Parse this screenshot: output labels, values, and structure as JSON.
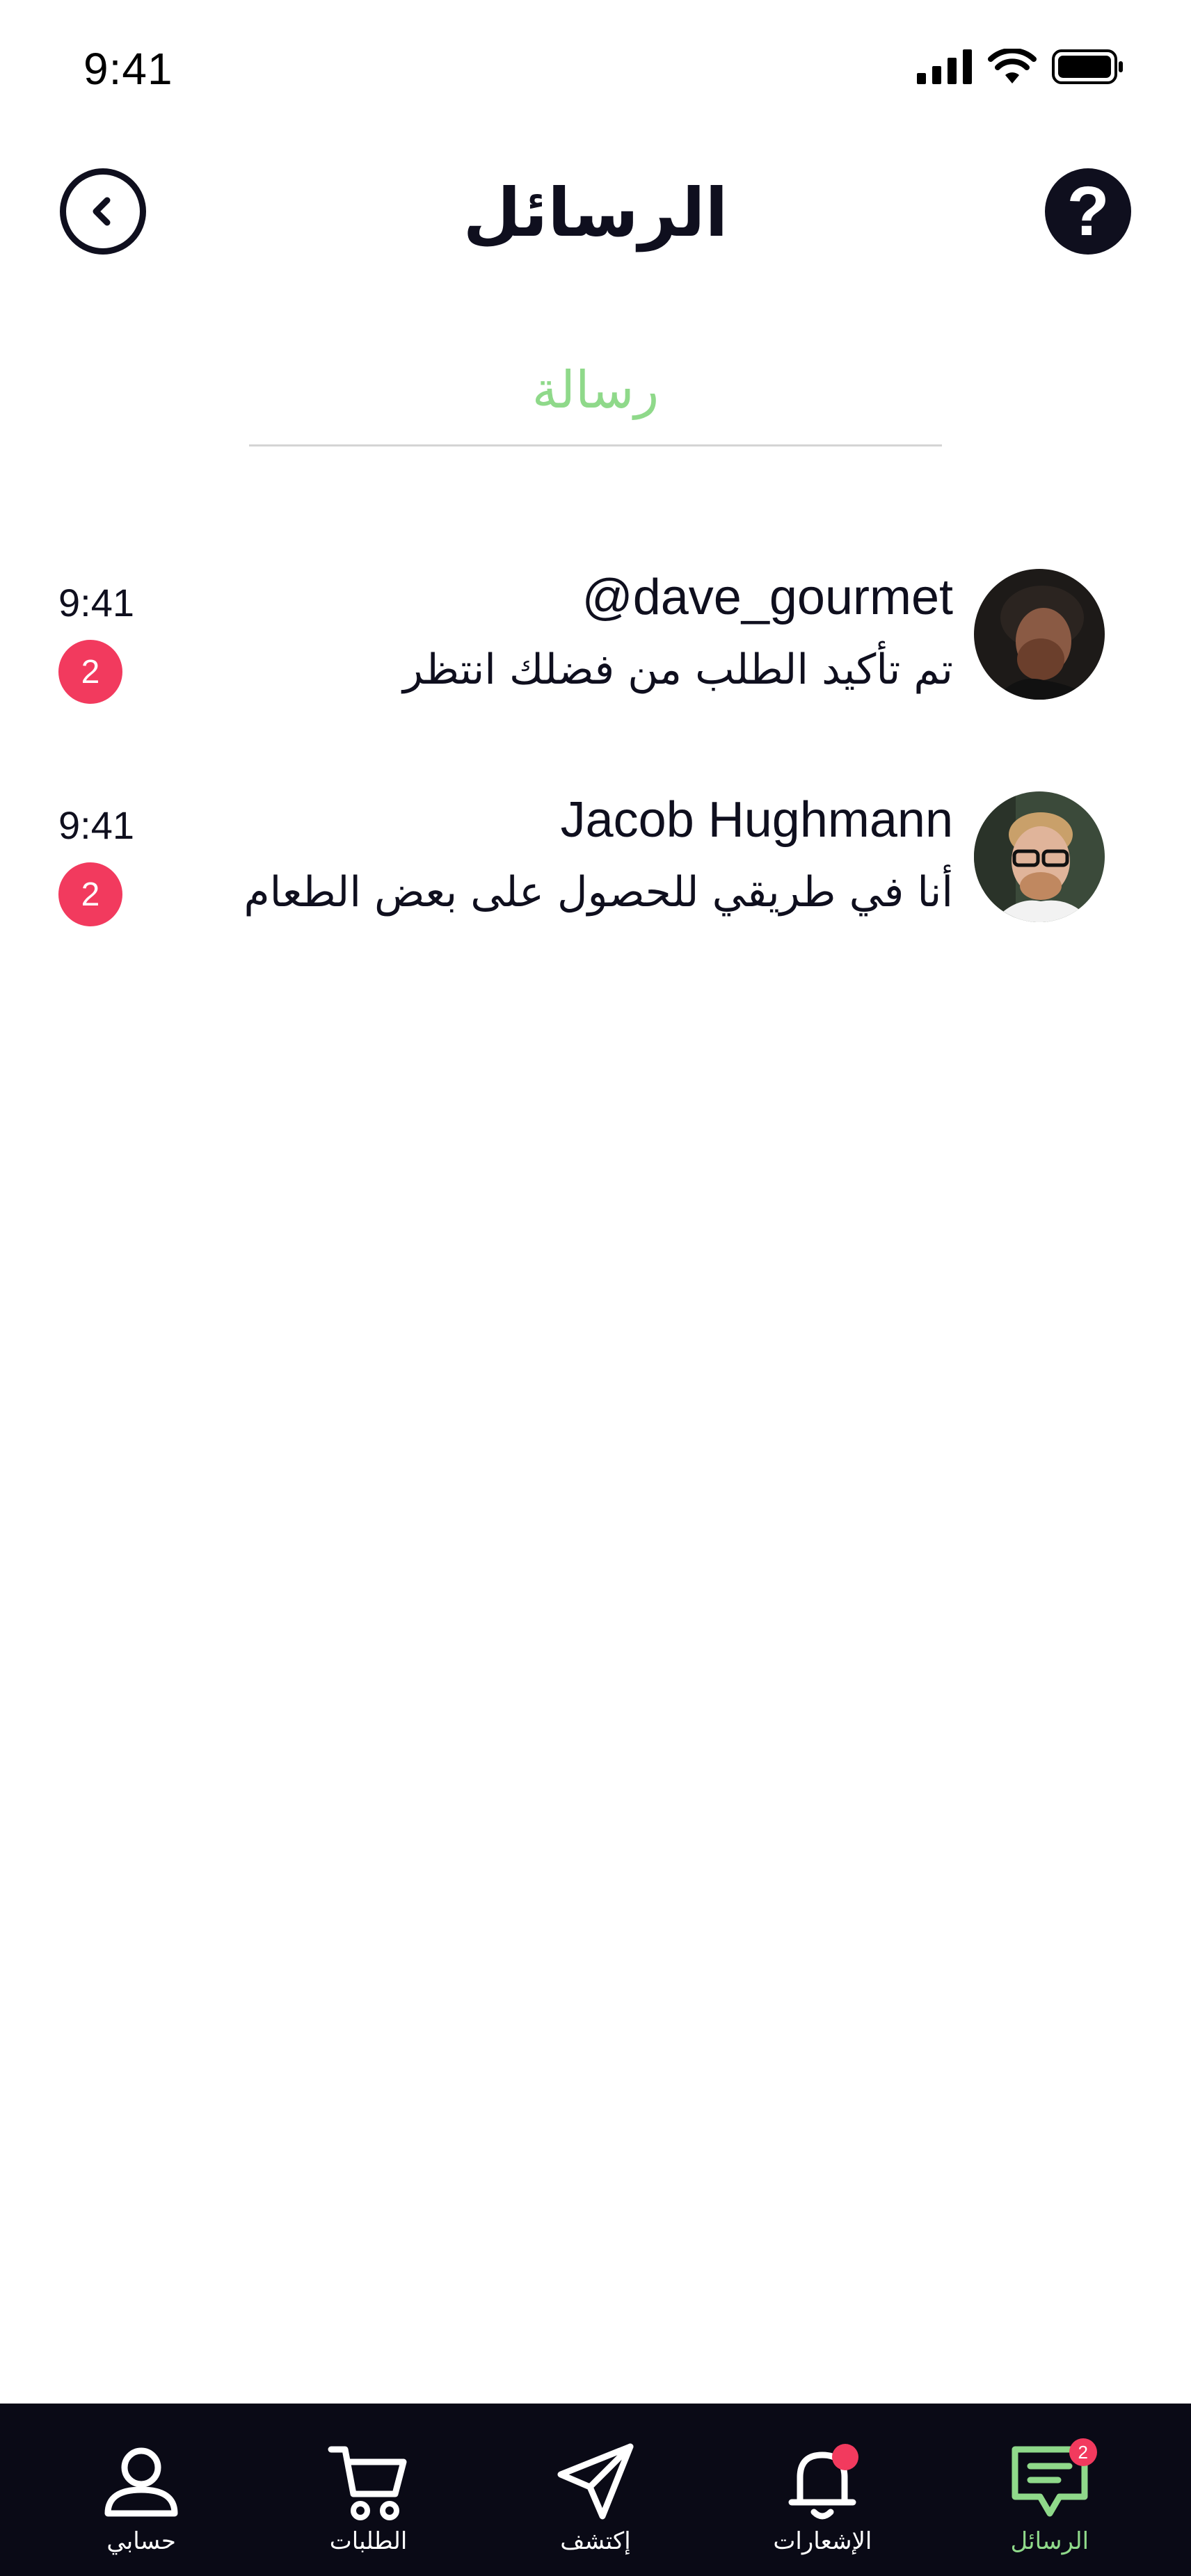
{
  "status_bar": {
    "time": "9:41"
  },
  "header": {
    "title": "الرسائل",
    "help_label": "?"
  },
  "tab": {
    "label": "رسالة",
    "accent": "#8fd98a"
  },
  "conversations": [
    {
      "name": "@dave_gourmet",
      "message": "تم تأكيد الطلب من فضلك انتظر",
      "time": "9:41",
      "unread": "2"
    },
    {
      "name": "Jacob Hughmann",
      "message": "أنا في طريقي للحصول على بعض الطعام",
      "time": "9:41",
      "unread": "2"
    }
  ],
  "bottom_nav": {
    "items": [
      {
        "label": "حسابي",
        "icon": "user-icon"
      },
      {
        "label": "الطلبات",
        "icon": "cart-icon"
      },
      {
        "label": "إكتشف",
        "icon": "send-icon"
      },
      {
        "label": "الإشعارات",
        "icon": "bell-icon"
      },
      {
        "label": "الرسائل",
        "icon": "message-icon",
        "badge": "2"
      }
    ]
  },
  "colors": {
    "badge": "#f23a5e",
    "nav_background": "#0a0a16",
    "text": "#0f0f1e"
  }
}
